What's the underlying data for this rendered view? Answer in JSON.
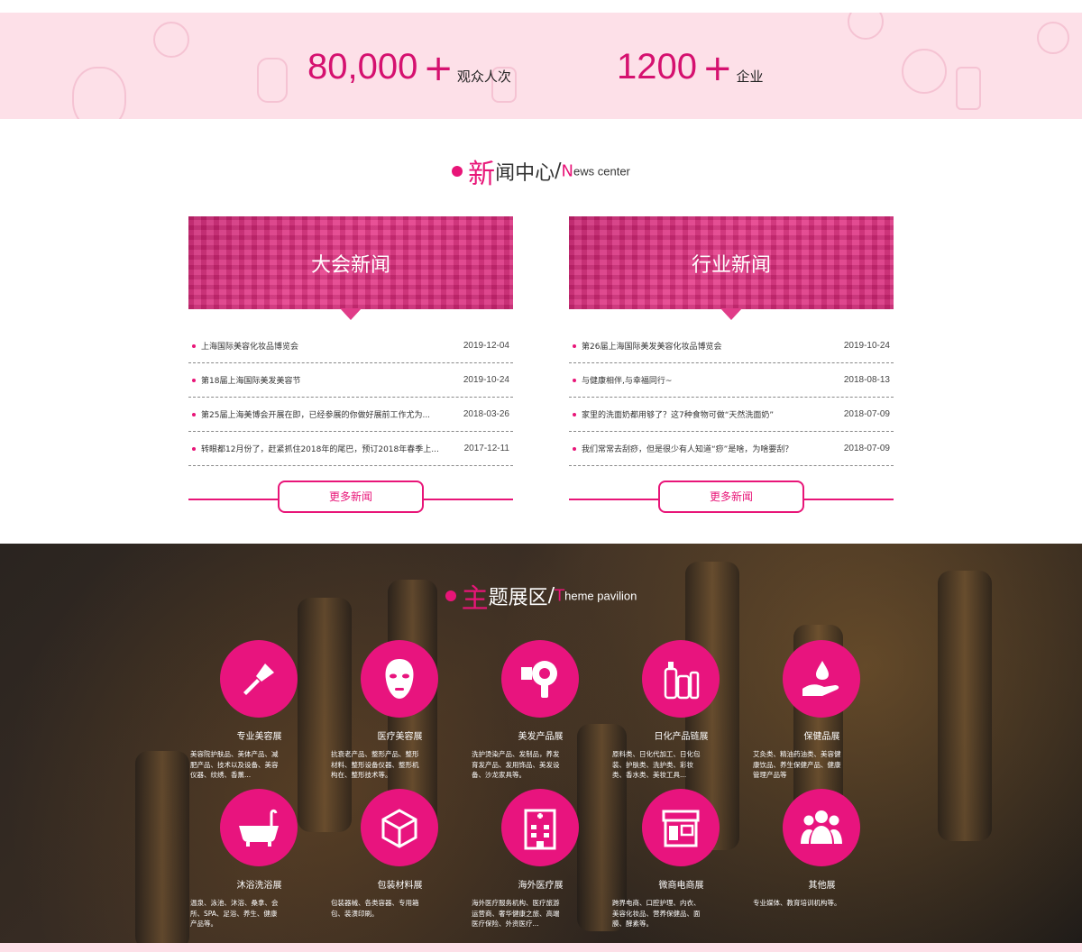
{
  "stats": [
    {
      "number": "80,000",
      "plus": "+",
      "unit": "观众人次"
    },
    {
      "number": "1200",
      "plus": "+",
      "unit": "企业"
    }
  ],
  "news": {
    "title_first": "新",
    "title_rest": "闻中心",
    "slash": "/",
    "en_first": "N",
    "en_rest": "ews center",
    "columns": [
      {
        "banner": "大会新闻",
        "items": [
          {
            "text": "上海国际美容化妆品博览会",
            "date": "2019-12-04"
          },
          {
            "text": "第18届上海国际美发美容节",
            "date": "2019-10-24"
          },
          {
            "text": "第25届上海美博会开展在即，已经参展的你做好展前工作尤为...",
            "date": "2018-03-26"
          },
          {
            "text": "转眼都12月份了，赶紧抓住2018年的尾巴，预订2018年春季上...",
            "date": "2017-12-11"
          }
        ],
        "more": "更多新闻"
      },
      {
        "banner": "行业新闻",
        "items": [
          {
            "text": "第26届上海国际美发美容化妆品博览会",
            "date": "2019-10-24"
          },
          {
            "text": "与健康相伴,与幸福同行~",
            "date": "2018-08-13"
          },
          {
            "text": "家里的洗面奶都用够了？这7种食物可做“天然洗面奶”",
            "date": "2018-07-09"
          },
          {
            "text": "我们常常去刮痧，但是很少有人知道“痧”是啥，为啥要刮？",
            "date": "2018-07-09"
          }
        ],
        "more": "更多新闻"
      }
    ]
  },
  "theme": {
    "title_first": "主",
    "title_rest": "题展区",
    "slash": "/",
    "en_first": "T",
    "en_rest": "heme pavilion",
    "cards": [
      {
        "name": "专业美容展",
        "icon": "makeup-brush-icon",
        "desc": "美容院护肤品、美体产品、减肥产品、技术以及设备、美容仪器、纹绣、香薰..."
      },
      {
        "name": "医疗美容展",
        "icon": "face-mask-icon",
        "desc": "抗衰老产品、整形产品、整形材料、整形设备仪器、整形机构在、整形技术等。"
      },
      {
        "name": "美发产品展",
        "icon": "hair-dryer-icon",
        "desc": "洗护烫染产品、发制品，养发育发产品、发用饰品、美发设备、沙龙家具等。"
      },
      {
        "name": "日化产品链展",
        "icon": "cosmetic-bottles-icon",
        "desc": "原料类、日化代加工、日化包装、护肤类、洗护类、彩妆类、香水类、美妆工具..."
      },
      {
        "name": "保健品展",
        "icon": "hand-drop-icon",
        "desc": "艾灸类、精油药油类、美容健康饮品、养生保健产品、健康管理产品等"
      },
      {
        "name": "沐浴洗浴展",
        "icon": "bathtub-icon",
        "desc": "温泉、泳池、沐浴、桑拿、会所、SPA、足浴、养生、健康产品等。"
      },
      {
        "name": "包装材料展",
        "icon": "package-box-icon",
        "desc": "包装器械、各类容器、专用箱包、装潢印刷。"
      },
      {
        "name": "海外医疗展",
        "icon": "hospital-building-icon",
        "desc": "海外医疗服务机构、医疗旅游运营商、奢华健康之旅、高端医疗保险、外资医疗..."
      },
      {
        "name": "微商电商展",
        "icon": "storefront-icon",
        "desc": "跨界电商、口腔护理、内衣、美容化妆品、营养保健品、面膜、酵素等。"
      },
      {
        "name": "其他展",
        "icon": "people-group-icon",
        "desc": "专业媒体、教育培训机构等。"
      }
    ]
  },
  "colors": {
    "accent": "#e8147e",
    "pink_bg": "#fde0e8"
  }
}
